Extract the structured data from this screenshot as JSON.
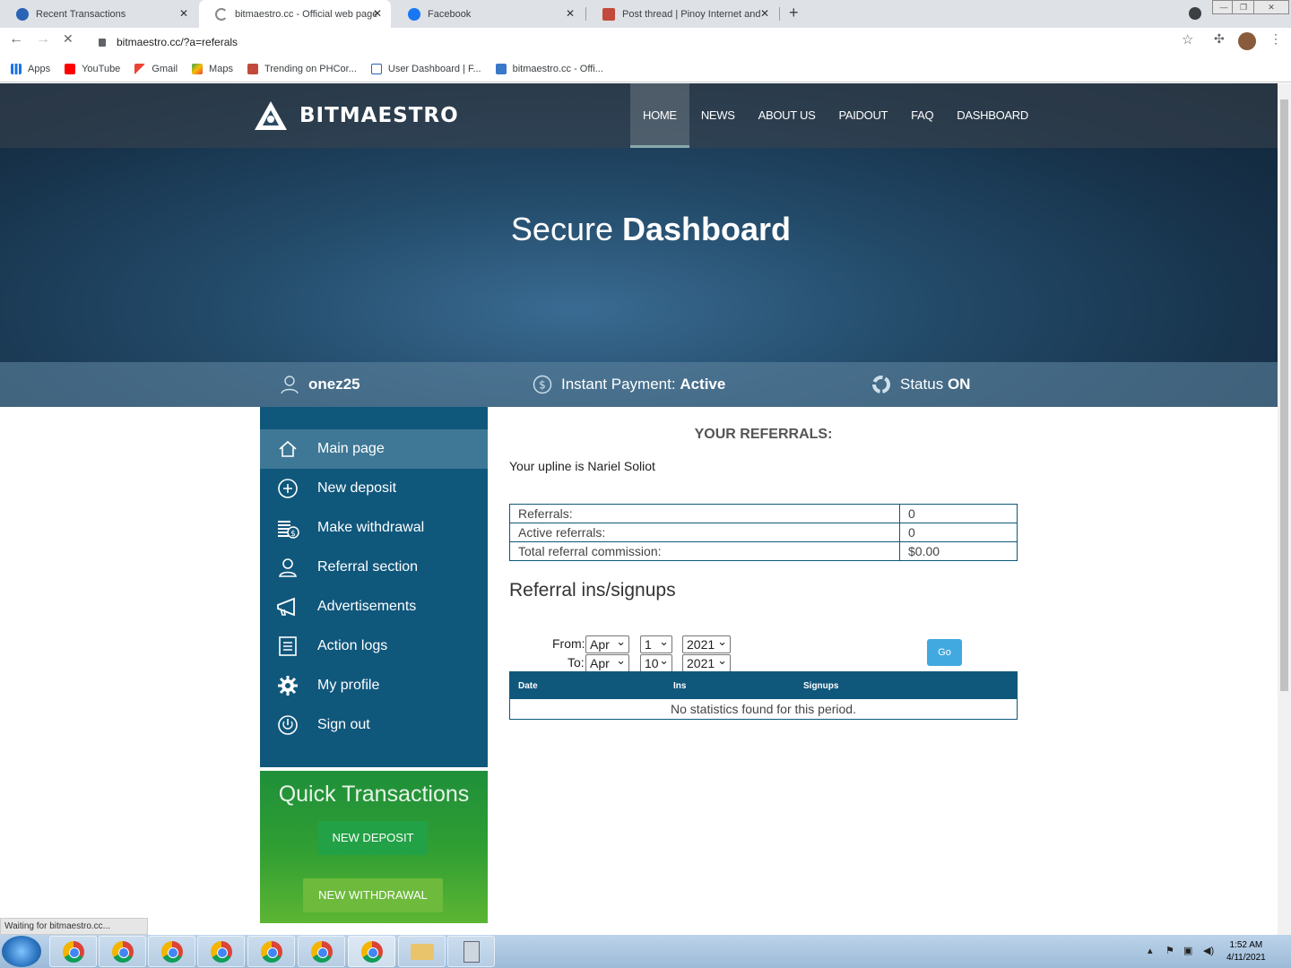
{
  "browser": {
    "tabs": [
      {
        "title": "Recent Transactions",
        "active": false
      },
      {
        "title": "bitmaestro.cc - Official web page",
        "active": true
      },
      {
        "title": "Facebook",
        "active": false
      },
      {
        "title": "Post thread | Pinoy Internet and",
        "active": false
      }
    ],
    "url": "bitmaestro.cc/?a=referals",
    "bookmarks": [
      "Apps",
      "YouTube",
      "Gmail",
      "Maps",
      "Trending on PHCor...",
      "User Dashboard | F...",
      "bitmaestro.cc - Offi..."
    ],
    "status_text": "Waiting for bitmaestro.cc..."
  },
  "site": {
    "brand": "BITMAESTRO",
    "nav": [
      "HOME",
      "NEWS",
      "ABOUT US",
      "PAIDOUT",
      "FAQ",
      "DASHBOARD"
    ],
    "hero_light": "Secure",
    "hero_bold": "Dashboard",
    "info": {
      "username": "onez25",
      "payment_label": "Instant Payment:",
      "payment_value": "Active",
      "status_label": "Status",
      "status_value": "ON"
    },
    "sidebar": [
      {
        "label": "Main page",
        "icon": "home-icon"
      },
      {
        "label": "New deposit",
        "icon": "plus-circle-icon"
      },
      {
        "label": "Make withdrawal",
        "icon": "coins-icon"
      },
      {
        "label": "Referral section",
        "icon": "user-icon"
      },
      {
        "label": "Advertisements",
        "icon": "megaphone-icon"
      },
      {
        "label": "Action logs",
        "icon": "list-icon"
      },
      {
        "label": "My profile",
        "icon": "gear-icon"
      },
      {
        "label": "Sign out",
        "icon": "power-icon"
      }
    ],
    "quick": {
      "title": "Quick Transactions",
      "deposit": "NEW DEPOSIT",
      "withdrawal": "NEW WITHDRAWAL"
    },
    "referrals": {
      "heading": "YOUR REFERRALS:",
      "upline": "Your upline is Nariel Soliot",
      "rows": [
        {
          "label": "Referrals:",
          "value": "0"
        },
        {
          "label": "Active referrals:",
          "value": "0"
        },
        {
          "label": "Total referral commission:",
          "value": "$0.00"
        }
      ],
      "signups_title": "Referral ins/signups",
      "from_label": "From:",
      "to_label": "To:",
      "from": {
        "month": "Apr",
        "day": "1",
        "year": "2021"
      },
      "to": {
        "month": "Apr",
        "day": "10",
        "year": "2021"
      },
      "go": "Go",
      "columns": [
        "Date",
        "Ins",
        "Signups"
      ],
      "empty": "No statistics found for this period."
    }
  },
  "taskbar": {
    "time": "1:52 AM",
    "date": "4/11/2021"
  }
}
